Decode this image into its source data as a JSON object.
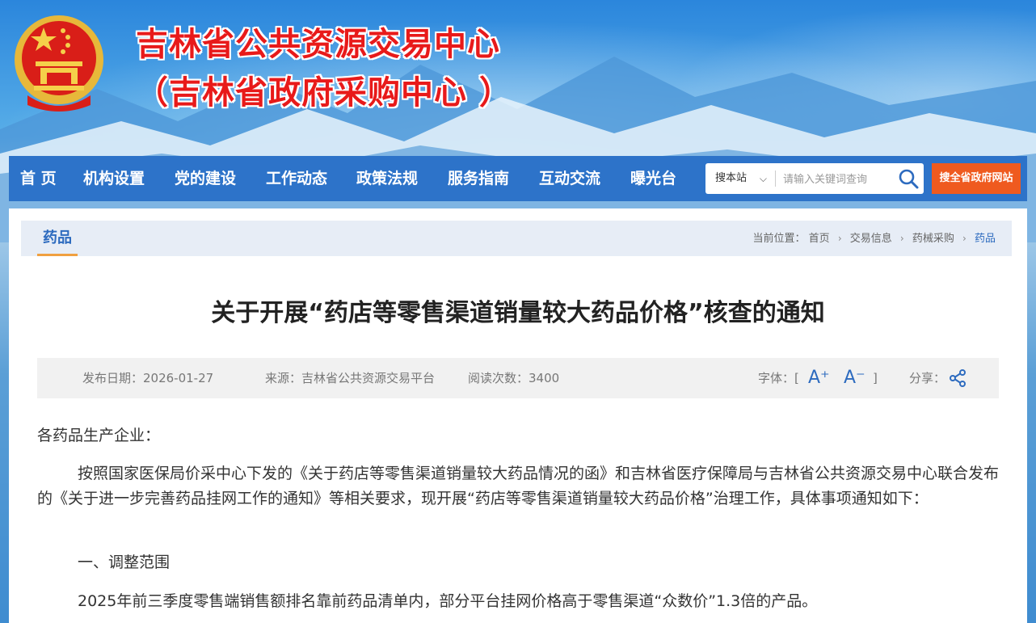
{
  "header": {
    "title_line1": "吉林省公共资源交易中心",
    "title_line2": "（吉林省政府采购中心 ）",
    "emblem": "national-emblem-icon",
    "colors": {
      "title": "#e81a1a",
      "nav": "#2d73c9",
      "accent_button": "#ef5a1f"
    }
  },
  "nav": {
    "items": [
      {
        "label": "首 页"
      },
      {
        "label": "机构设置"
      },
      {
        "label": "党的建设"
      },
      {
        "label": "工作动态"
      },
      {
        "label": "政策法规"
      },
      {
        "label": "服务指南"
      },
      {
        "label": "互动交流"
      },
      {
        "label": "曝光台"
      }
    ],
    "search": {
      "scope": "搜本站",
      "placeholder": "请输入关键词查询",
      "icon": "search-icon"
    },
    "gov_search_button": "搜全省政府网站"
  },
  "section": {
    "tab": "药品",
    "breadcrumb": {
      "prefix": "当前位置：",
      "items": [
        "首页",
        "交易信息",
        "药械采购",
        "药品"
      ]
    }
  },
  "article": {
    "title": "关于开展“药店等零售渠道销量较大药品价格”核查的通知",
    "meta": {
      "date": "发布日期：2026-01-27",
      "source": "来源：吉林省公共资源交易平台",
      "views": "阅读次数：3400",
      "font_label": "字体：[",
      "font_increase": "A⁺",
      "font_decrease": "A⁻",
      "font_close": "]",
      "share_label": "分享："
    },
    "paragraphs": [
      "各药品生产企业：",
      "按照国家医保局价采中心下发的《关于药店等零售渠道销量较大药品情况的函》和吉林省医疗保障局与吉林省公共资源交易中心联合发布的《关于进一步完善药品挂网工作的通知》等相关要求，现开展“药店等零售渠道销量较大药品价格”治理工作，具体事项通知如下：",
      "一、调整范围",
      "2025年前三季度零售端销售额排名靠前药品清单内，部分平台挂网价格高于零售渠道“众数价”1.3倍的产品。"
    ]
  }
}
